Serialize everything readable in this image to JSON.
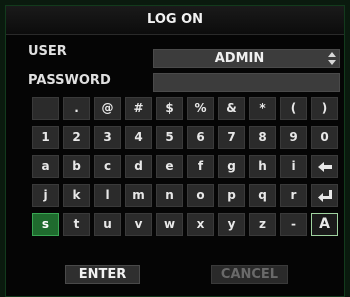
{
  "dialog": {
    "title": "LOG ON"
  },
  "user": {
    "label": "USER",
    "value": "ADMIN"
  },
  "password": {
    "label": "PASSWORD",
    "value": ""
  },
  "keyboard": {
    "rows": [
      [
        "",
        ".",
        "@",
        "#",
        "$",
        "%",
        "&",
        "*",
        "(",
        ")"
      ],
      [
        "1",
        "2",
        "3",
        "4",
        "5",
        "6",
        "7",
        "8",
        "9",
        "0"
      ],
      [
        "a",
        "b",
        "c",
        "d",
        "e",
        "f",
        "g",
        "h",
        "i",
        "backspace"
      ],
      [
        "j",
        "k",
        "l",
        "m",
        "n",
        "o",
        "p",
        "q",
        "r",
        "enter"
      ],
      [
        "s",
        "t",
        "u",
        "v",
        "w",
        "x",
        "y",
        "z",
        "-",
        "A"
      ]
    ],
    "selected_key": "s"
  },
  "buttons": {
    "enter": "ENTER",
    "cancel": "CANCEL"
  },
  "colors": {
    "selected_key": "#1f6b2e",
    "dialog_border": "#123a1c",
    "disabled_text": "#6a6a6a"
  }
}
